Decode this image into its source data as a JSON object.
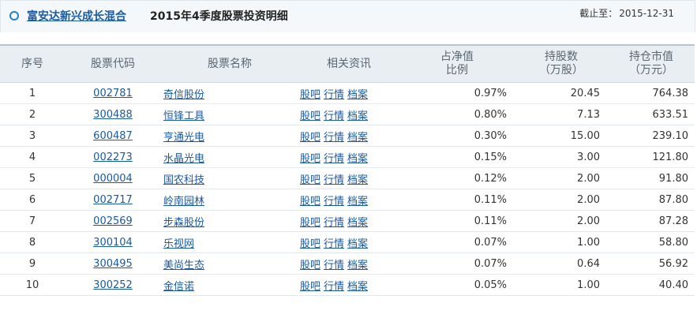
{
  "header": {
    "fund_name": "富安达新兴成长混合",
    "title": "2015年4季度股票投资明细",
    "as_of_label": "截止至：",
    "as_of_date": "2015-12-31"
  },
  "columns": {
    "idx": "序号",
    "code": "股票代码",
    "name": "股票名称",
    "news": "相关资讯",
    "ratio_1": "占净值",
    "ratio_2": "比例",
    "shares_1": "持股数",
    "shares_2": "（万股）",
    "value_1": "持仓市值",
    "value_2": "（万元）"
  },
  "news_links": [
    "股吧",
    "行情",
    "档案"
  ],
  "rows": [
    {
      "idx": "1",
      "code": "002781",
      "name": "奇信股份",
      "ratio": "0.97%",
      "shares": "20.45",
      "value": "764.38"
    },
    {
      "idx": "2",
      "code": "300488",
      "name": "恒锋工具",
      "ratio": "0.80%",
      "shares": "7.13",
      "value": "633.51"
    },
    {
      "idx": "3",
      "code": "600487",
      "name": "亨通光电",
      "ratio": "0.30%",
      "shares": "15.00",
      "value": "239.10"
    },
    {
      "idx": "4",
      "code": "002273",
      "name": "水晶光电",
      "ratio": "0.15%",
      "shares": "3.00",
      "value": "121.80"
    },
    {
      "idx": "5",
      "code": "000004",
      "name": "国农科技",
      "ratio": "0.12%",
      "shares": "2.00",
      "value": "91.80"
    },
    {
      "idx": "6",
      "code": "002717",
      "name": "岭南园林",
      "ratio": "0.11%",
      "shares": "2.00",
      "value": "87.80"
    },
    {
      "idx": "7",
      "code": "002569",
      "name": "步森股份",
      "ratio": "0.11%",
      "shares": "2.00",
      "value": "87.28"
    },
    {
      "idx": "8",
      "code": "300104",
      "name": "乐视网",
      "ratio": "0.07%",
      "shares": "1.00",
      "value": "58.80"
    },
    {
      "idx": "9",
      "code": "300495",
      "name": "美尚生态",
      "ratio": "0.07%",
      "shares": "0.64",
      "value": "56.92"
    },
    {
      "idx": "10",
      "code": "300252",
      "name": "金信诺",
      "ratio": "0.05%",
      "shares": "1.00",
      "value": "40.40"
    }
  ],
  "colors": {
    "link": "#1a5aa0",
    "header_bg": "#e9eef3",
    "accent_dot": "#1f84d1"
  }
}
